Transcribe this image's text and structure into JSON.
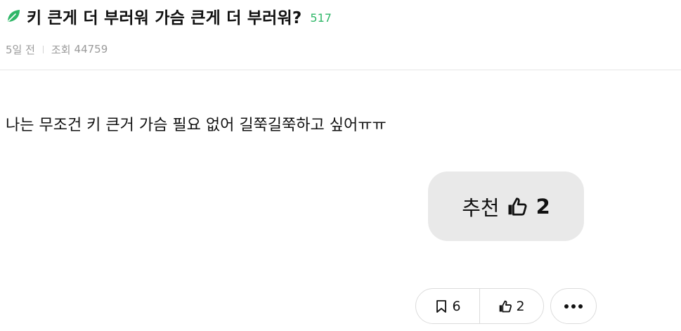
{
  "post": {
    "title": "키 큰게 더 부러워 가슴 큰게 더 부러워?",
    "comment_count": "517",
    "title_icon": "leaf-icon",
    "accent_color": "#2fb768",
    "meta": {
      "time_ago": "5일 전",
      "views_label": "조회",
      "views_count": "44759"
    },
    "body": "나는 무조건 키 큰거 가슴 필요 없어 길쭉길쭉하고 싶어ㅠㅠ"
  },
  "recommend": {
    "label": "추천",
    "icon": "thumbs-up-icon",
    "count": "2"
  },
  "actions": {
    "bookmark_icon": "bookmark-icon",
    "bookmark_count": "6",
    "like_icon": "thumbs-up-icon",
    "like_count": "2",
    "more_icon": "more-dots-icon"
  }
}
